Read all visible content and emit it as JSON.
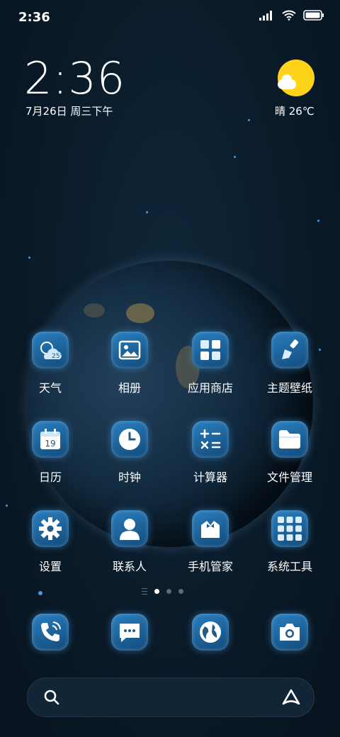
{
  "status_bar": {
    "time": "2:36"
  },
  "clock_widget": {
    "time": "2:36",
    "date": "7月26日 周三下午"
  },
  "weather_widget": {
    "text": "晴 26℃",
    "icon": "sunny-cloud-icon"
  },
  "apps": [
    {
      "label": "天气",
      "icon": "weather-icon",
      "badge": "25°"
    },
    {
      "label": "相册",
      "icon": "gallery-icon"
    },
    {
      "label": "应用商店",
      "icon": "app-store-icon"
    },
    {
      "label": "主题壁纸",
      "icon": "brush-icon"
    },
    {
      "label": "日历",
      "icon": "calendar-icon",
      "badge": "19"
    },
    {
      "label": "时钟",
      "icon": "clock-icon"
    },
    {
      "label": "计算器",
      "icon": "calculator-icon"
    },
    {
      "label": "文件管理",
      "icon": "folder-icon"
    },
    {
      "label": "设置",
      "icon": "gear-icon"
    },
    {
      "label": "联系人",
      "icon": "contact-icon"
    },
    {
      "label": "手机管家",
      "icon": "security-icon"
    },
    {
      "label": "系统工具",
      "icon": "tools-folder-icon"
    }
  ],
  "dock": [
    {
      "icon": "phone-icon"
    },
    {
      "icon": "message-icon"
    },
    {
      "icon": "browser-icon"
    },
    {
      "icon": "camera-icon"
    }
  ],
  "page_indicator": {
    "pages": 3,
    "active": 1
  },
  "search_bar": {
    "left_icon": "search-icon",
    "right_icon": "assistant-icon"
  },
  "colors": {
    "icon_gradient_top": "#2a7fbf",
    "icon_gradient_bottom": "#124a7a",
    "sun": "#ffd31a"
  }
}
